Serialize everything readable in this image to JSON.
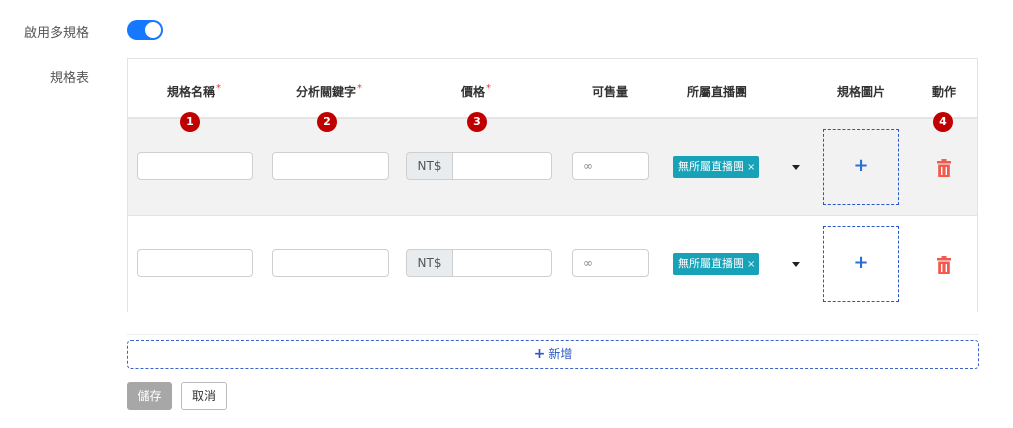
{
  "form": {
    "multi_spec_label": "啟用多規格",
    "multi_spec_enabled": true,
    "spec_table_label": "規格表"
  },
  "table": {
    "headers": [
      "規格名稱",
      "分析關鍵字",
      "價格",
      "可售量",
      "所屬直播團",
      "規格圖片",
      "動作"
    ],
    "required_marker": "*",
    "badges": [
      "1",
      "2",
      "3",
      "4"
    ],
    "rows": [
      {
        "name": "",
        "keyword": "",
        "currency": "NT$",
        "price": "",
        "quantity": "∞",
        "live_group_tag": "無所屬直播團",
        "tag_close": "×",
        "upload_plus": "+"
      },
      {
        "name": "",
        "keyword": "",
        "currency": "NT$",
        "price": "",
        "quantity": "∞",
        "live_group_tag": "無所屬直播團",
        "tag_close": "×",
        "upload_plus": "+"
      }
    ]
  },
  "actions": {
    "add_plus": "+",
    "add_label": "新增",
    "save_label": "儲存",
    "cancel_label": "取消"
  },
  "colors": {
    "toggle": "#1677ff",
    "tag": "#17a2b8",
    "trash": "#f15a4f",
    "badge": "#c00000",
    "dashed_border": "#2b58c9"
  },
  "icons": {
    "delete": "trash-icon",
    "dropdown": "caret-down-icon"
  }
}
